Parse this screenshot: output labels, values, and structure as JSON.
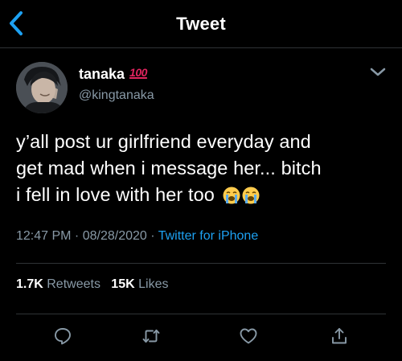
{
  "nav": {
    "title": "Tweet"
  },
  "author": {
    "display_name": "tanaka",
    "badge_emoji": "100",
    "handle": "@kingtanaka"
  },
  "tweet": {
    "line1": "y’all post ur girlfriend everyday and",
    "line2": "get mad when i message her... bitch",
    "line3": "i fell in love with her too"
  },
  "meta": {
    "time": "12:47 PM",
    "sep1": " · ",
    "date": "08/28/2020",
    "sep2": " · ",
    "source": "Twitter for iPhone"
  },
  "stats": {
    "retweets_count": "1.7K",
    "retweets_label": "Retweets",
    "likes_count": "15K",
    "likes_label": "Likes"
  },
  "icons": [
    "back-chevron-icon",
    "chevron-down-icon",
    "loudly-crying-face-icon",
    "reply-icon",
    "retweet-icon",
    "like-icon",
    "share-icon"
  ],
  "colors": {
    "background": "#000000",
    "accent": "#1da1f2",
    "secondary_text": "#8899a6",
    "divider": "#2f3336",
    "badge": "#e0245e"
  }
}
